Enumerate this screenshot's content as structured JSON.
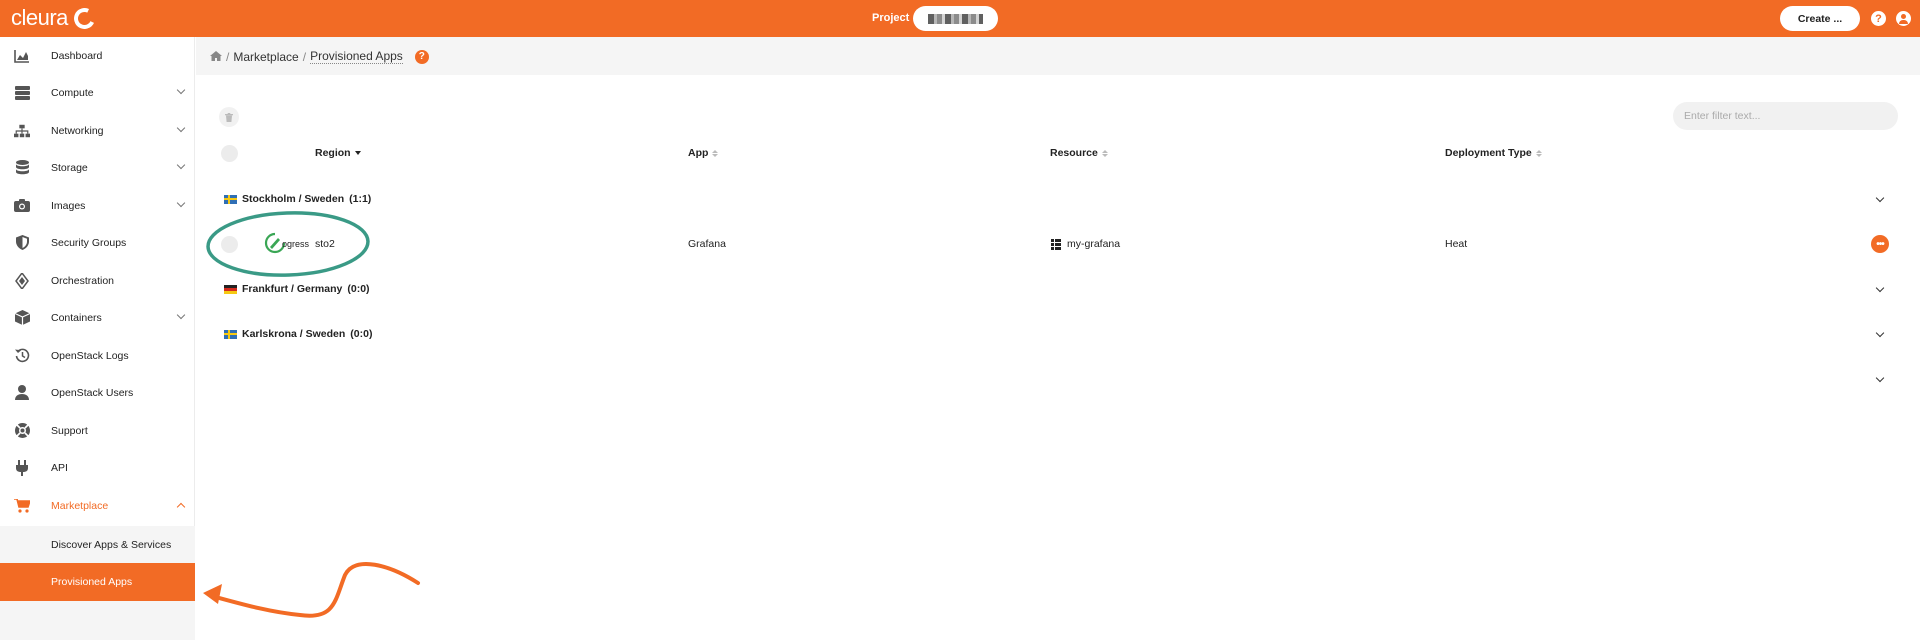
{
  "topbar": {
    "brand": "cleura",
    "project_label": "Project",
    "create_label": "Create ...",
    "help_glyph": "?",
    "colors": {
      "brand": "#f26b25"
    }
  },
  "sidebar": {
    "items": [
      {
        "label": "Dashboard",
        "icon": "chart-area-icon"
      },
      {
        "label": "Compute",
        "icon": "server-icon"
      },
      {
        "label": "Networking",
        "icon": "sitemap-icon"
      },
      {
        "label": "Storage",
        "icon": "database-icon"
      },
      {
        "label": "Images",
        "icon": "camera-icon"
      },
      {
        "label": "Security Groups",
        "icon": "shield-icon"
      },
      {
        "label": "Orchestration",
        "icon": "layers-icon"
      },
      {
        "label": "Containers",
        "icon": "cube-icon"
      },
      {
        "label": "OpenStack Logs",
        "icon": "history-icon"
      },
      {
        "label": "OpenStack Users",
        "icon": "user-icon"
      },
      {
        "label": "Support",
        "icon": "life-ring-icon"
      },
      {
        "label": "API",
        "icon": "plug-icon"
      },
      {
        "label": "Marketplace",
        "icon": "cart-icon"
      }
    ],
    "submenu": [
      {
        "label": "Discover Apps & Services"
      },
      {
        "label": "Provisioned Apps"
      }
    ]
  },
  "breadcrumb": {
    "items": [
      "Marketplace",
      "Provisioned Apps"
    ],
    "separator": "/"
  },
  "toolbar": {
    "filter_placeholder": "Enter filter text..."
  },
  "table": {
    "headers": {
      "region": "Region",
      "app": "App",
      "resource": "Resource",
      "deployment_type": "Deployment Type"
    },
    "groups": [
      {
        "label": "Stockholm / Sweden",
        "count": "(1:1)",
        "flag": "sweden-flag-icon"
      },
      {
        "label": "Frankfurt / Germany",
        "count": "(0:0)",
        "flag": "germany-flag-icon"
      },
      {
        "label": "Karlskrona / Sweden",
        "count": "(0:0)",
        "flag": "sweden-flag-icon"
      }
    ],
    "row": {
      "status": "ogress",
      "region": "sto2",
      "app": "Grafana",
      "resource": "my-grafana",
      "deployment_type": "Heat",
      "more_glyph": "•••"
    }
  }
}
